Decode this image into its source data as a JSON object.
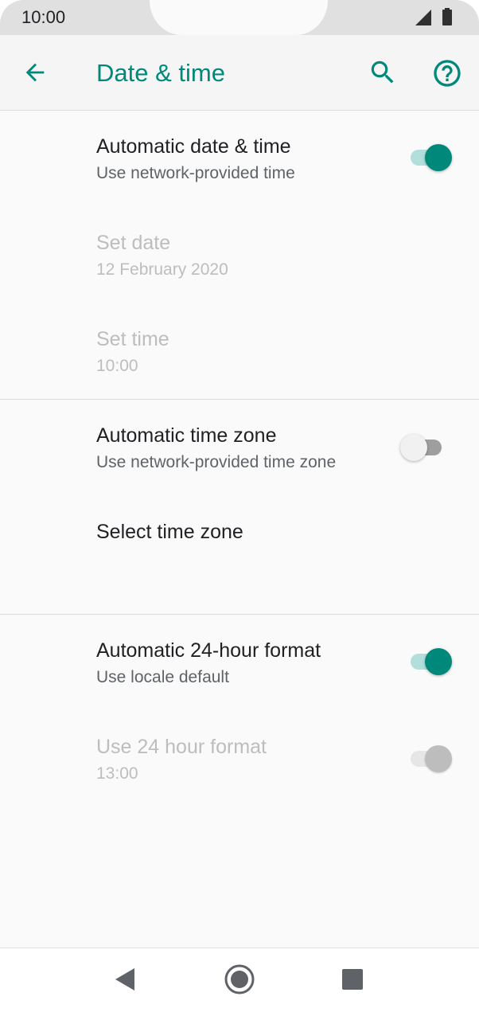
{
  "status_bar": {
    "time": "10:00",
    "icons": [
      "cell-signal-icon",
      "battery-icon"
    ]
  },
  "app_bar": {
    "title": "Date & time",
    "icons": [
      "back-arrow-icon",
      "search-icon",
      "help-icon"
    ]
  },
  "settings": {
    "auto_date_time": {
      "title": "Automatic date & time",
      "subtitle": "Use network-provided time",
      "toggle": "on"
    },
    "set_date": {
      "title": "Set date",
      "subtitle": "12 February 2020",
      "enabled": false
    },
    "set_time": {
      "title": "Set time",
      "subtitle": "10:00",
      "enabled": false
    },
    "auto_time_zone": {
      "title": "Automatic time zone",
      "subtitle": "Use network-provided time zone",
      "toggle": "off"
    },
    "select_time_zone": {
      "title": "Select time zone"
    },
    "auto_24_hour": {
      "title": "Automatic 24-hour format",
      "subtitle": "Use locale default",
      "toggle": "on"
    },
    "use_24_hour": {
      "title": "Use 24 hour format",
      "subtitle": "13:00",
      "toggle": "on",
      "enabled": false
    }
  },
  "nav_bar": {
    "icons": [
      "nav-back-icon",
      "nav-home-icon",
      "nav-recents-icon"
    ]
  },
  "colors": {
    "accent": "#00897b",
    "accent_track": "#b2dfdb",
    "background": "#fafafa",
    "disabled_text": "#bdbdbd"
  }
}
